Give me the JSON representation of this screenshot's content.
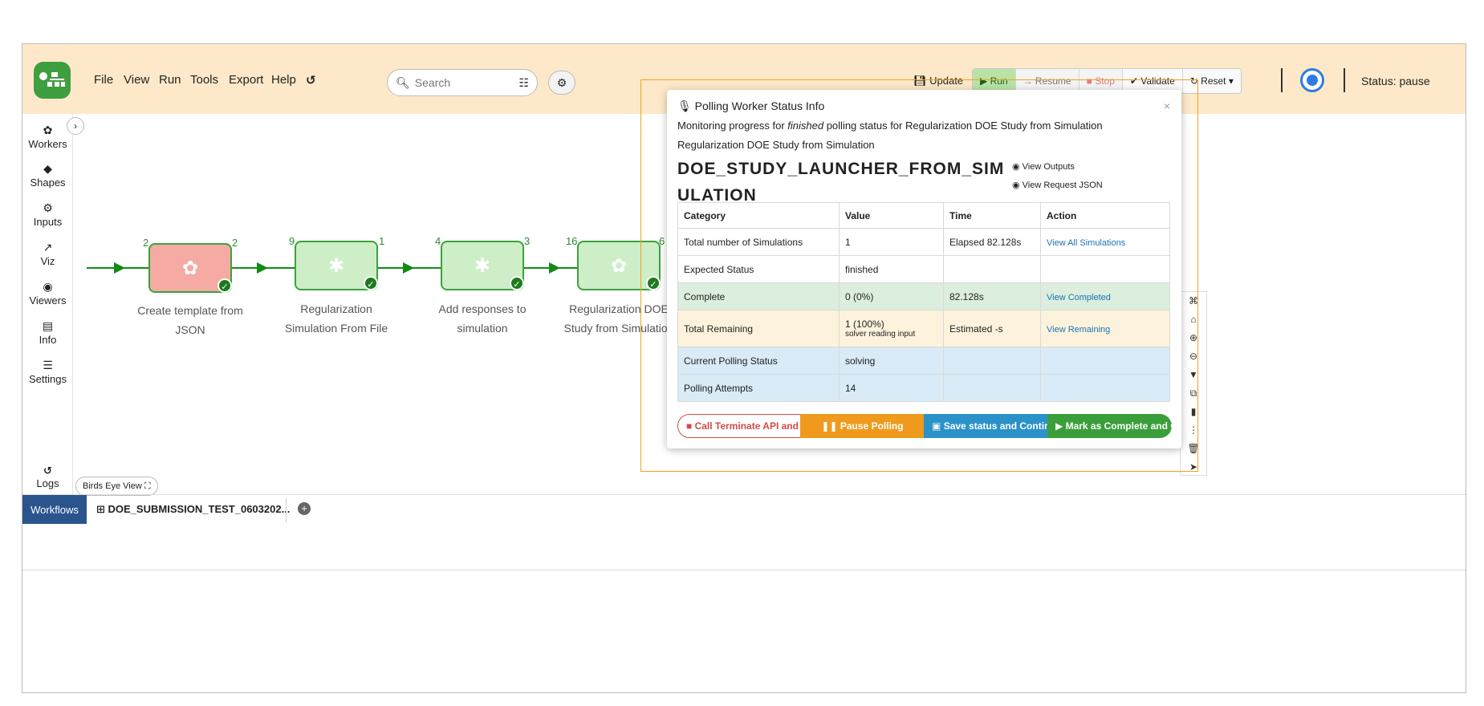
{
  "menu": [
    "File",
    "View",
    "Run",
    "Tools",
    "Export",
    "Help"
  ],
  "search": {
    "placeholder": "Search"
  },
  "toolbar": {
    "update": "Update",
    "run": "Run",
    "resume": "Resume",
    "stop": "Stop",
    "validate": "Validate",
    "reset": "Reset",
    "status": "Status: pause"
  },
  "rail": [
    {
      "icon": "gear-icon",
      "glyph": "✿",
      "label": "Workers"
    },
    {
      "icon": "diamond-icon",
      "glyph": "◆",
      "label": "Shapes"
    },
    {
      "icon": "cogs-icon",
      "glyph": "⚙",
      "label": "Inputs"
    },
    {
      "icon": "chart-icon",
      "glyph": "📈",
      "label": "Viz"
    },
    {
      "icon": "eye-icon",
      "glyph": "◉",
      "label": "Viewers"
    },
    {
      "icon": "file-icon",
      "glyph": "▤",
      "label": "Info"
    },
    {
      "icon": "sliders-icon",
      "glyph": "☰",
      "label": "Settings"
    }
  ],
  "logs_label": "Logs",
  "birds_eye": "Birds Eye View",
  "tabs": {
    "workflows": "Workflows",
    "document": "DOE_SUBMISSION_TEST_0603202..."
  },
  "nodes": [
    {
      "in": "2",
      "out": "2",
      "label1": "Create template from",
      "label2": "JSON",
      "color": "red"
    },
    {
      "in": "9",
      "out": "1",
      "label1": "Regularization",
      "label2": "Simulation From File",
      "color": "green"
    },
    {
      "in": "4",
      "out": "3",
      "label1": "Add responses to",
      "label2": "simulation",
      "color": "green"
    },
    {
      "in": "16",
      "out": "6",
      "label1": "Regularization DOE",
      "label2": "Study from Simulation",
      "color": "green"
    }
  ],
  "popup": {
    "title": "Polling Worker Status Info",
    "desc_pre": "Monitoring progress for ",
    "desc_em": "finished",
    "desc_post": " polling status for Regularization DOE Study from Simulation",
    "subtitle": "Regularization DOE Study from Simulation",
    "worker_name": "DOE_STUDY_LAUNCHER_FROM_SIMULATION",
    "view_outputs": "View Outputs",
    "view_request": "View Request JSON",
    "headers": [
      "Category",
      "Value",
      "Time",
      "Action"
    ],
    "rows": [
      {
        "category": "Total number of Simulations",
        "value": "1",
        "value_sub": "",
        "time": "Elapsed 82.128s",
        "action": "View All Simulations",
        "style": ""
      },
      {
        "category": "Expected Status",
        "value": "finished",
        "value_sub": "",
        "time": "",
        "action": "",
        "style": ""
      },
      {
        "category": "Complete",
        "value": "0 (0%)",
        "value_sub": "",
        "time": "82.128s",
        "action": "View Completed",
        "style": "complete"
      },
      {
        "category": "Total Remaining",
        "value": "1 (100%)",
        "value_sub": "solver reading input",
        "time": "Estimated -s",
        "action": "View Remaining",
        "style": "remain"
      },
      {
        "category": "Current Polling Status",
        "value": "solving",
        "value_sub": "",
        "time": "",
        "action": "",
        "style": "info"
      },
      {
        "category": "Polling Attempts",
        "value": "14",
        "value_sub": "",
        "time": "",
        "action": "",
        "style": "info"
      }
    ],
    "buttons": {
      "terminate": "Call Terminate API and c",
      "pause": "Pause Polling",
      "save": "Save status and Continue",
      "mark": "Mark as Complete and Continue"
    }
  }
}
